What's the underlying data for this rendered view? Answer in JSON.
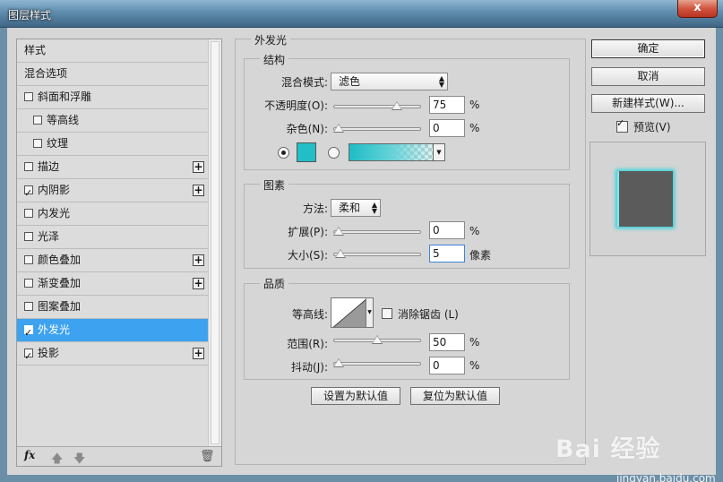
{
  "window": {
    "title": "图层样式",
    "close": "x"
  },
  "sidebar": {
    "items": [
      {
        "label": "样式",
        "checkbox": false,
        "checked": false,
        "plus": false,
        "sub": false,
        "selected": false
      },
      {
        "label": "混合选项",
        "checkbox": false,
        "checked": false,
        "plus": false,
        "sub": false,
        "selected": false
      },
      {
        "label": "斜面和浮雕",
        "checkbox": true,
        "checked": false,
        "plus": false,
        "sub": false,
        "selected": false
      },
      {
        "label": "等高线",
        "checkbox": true,
        "checked": false,
        "plus": false,
        "sub": true,
        "selected": false
      },
      {
        "label": "纹理",
        "checkbox": true,
        "checked": false,
        "plus": false,
        "sub": true,
        "selected": false
      },
      {
        "label": "描边",
        "checkbox": true,
        "checked": false,
        "plus": true,
        "sub": false,
        "selected": false
      },
      {
        "label": "内阴影",
        "checkbox": true,
        "checked": true,
        "plus": true,
        "sub": false,
        "selected": false
      },
      {
        "label": "内发光",
        "checkbox": true,
        "checked": false,
        "plus": false,
        "sub": false,
        "selected": false
      },
      {
        "label": "光泽",
        "checkbox": true,
        "checked": false,
        "plus": false,
        "sub": false,
        "selected": false
      },
      {
        "label": "颜色叠加",
        "checkbox": true,
        "checked": false,
        "plus": true,
        "sub": false,
        "selected": false
      },
      {
        "label": "渐变叠加",
        "checkbox": true,
        "checked": false,
        "plus": true,
        "sub": false,
        "selected": false
      },
      {
        "label": "图案叠加",
        "checkbox": true,
        "checked": false,
        "plus": false,
        "sub": false,
        "selected": false
      },
      {
        "label": "外发光",
        "checkbox": true,
        "checked": true,
        "plus": false,
        "sub": false,
        "selected": true
      },
      {
        "label": "投影",
        "checkbox": true,
        "checked": true,
        "plus": true,
        "sub": false,
        "selected": false
      }
    ],
    "footer": {
      "fx": "fx"
    }
  },
  "panel": {
    "title": "外发光",
    "structure": {
      "title": "结构",
      "blend_label": "混合模式:",
      "blend_value": "滤色",
      "opacity_label": "不透明度(O):",
      "opacity_value": "75",
      "opacity_fraction": 0.75,
      "noise_label": "杂色(N):",
      "noise_value": "0",
      "noise_fraction": 0,
      "percent": "%",
      "glow_color": "#22bec8"
    },
    "elements": {
      "title": "图素",
      "method_label": "方法:",
      "method_value": "柔和",
      "spread_label": "扩展(P):",
      "spread_value": "0",
      "spread_fraction": 0,
      "size_label": "大小(S):",
      "size_value": "5",
      "size_fraction": 0.02,
      "px_unit": "像素"
    },
    "quality": {
      "title": "品质",
      "contour_label": "等高线:",
      "antialias_label": "消除锯齿 (L)",
      "range_label": "范围(R):",
      "range_value": "50",
      "range_fraction": 0.5,
      "jitter_label": "抖动(J):",
      "jitter_value": "0",
      "jitter_fraction": 0
    },
    "set_default": "设置为默认值",
    "reset_default": "复位为默认值"
  },
  "actions": {
    "ok": "确定",
    "cancel": "取消",
    "new_style": "新建样式(W)...",
    "preview_label": "预览(V)",
    "preview_checked": true
  },
  "watermark": {
    "brand": "Bai 经验",
    "url": "jingyan.baidu.com"
  }
}
